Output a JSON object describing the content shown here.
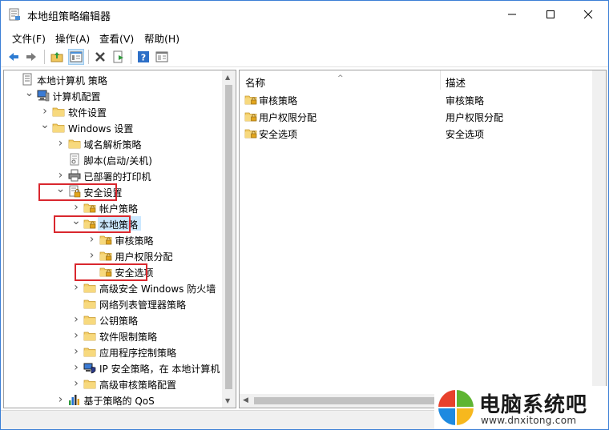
{
  "window": {
    "title": "本地组策略编辑器",
    "controls": {
      "minimize": "minimize",
      "maximize": "maximize",
      "close": "close"
    }
  },
  "menu": [
    {
      "label": "文件(F)"
    },
    {
      "label": "操作(A)"
    },
    {
      "label": "查看(V)"
    },
    {
      "label": "帮助(H)"
    }
  ],
  "toolbar": {
    "icons": [
      "back-arrow-icon",
      "forward-arrow-icon",
      "up-folder-icon",
      "show-tree-icon",
      "delete-icon",
      "export-list-icon",
      "help-icon",
      "properties-icon"
    ]
  },
  "tree": {
    "items": [
      {
        "label": "本地计算机 策略",
        "icon": "policy-document-icon",
        "expander": "none",
        "depth": 0
      },
      {
        "label": "计算机配置",
        "icon": "computer-icon",
        "expander": "expanded",
        "depth": 1
      },
      {
        "label": "软件设置",
        "icon": "folder-icon",
        "expander": "collapsed",
        "depth": 2
      },
      {
        "label": "Windows 设置",
        "icon": "folder-icon",
        "expander": "expanded",
        "depth": 2
      },
      {
        "label": "域名解析策略",
        "icon": "folder-icon",
        "expander": "collapsed",
        "depth": 3
      },
      {
        "label": "脚本(启动/关机)",
        "icon": "script-icon",
        "expander": "none",
        "depth": 3
      },
      {
        "label": "已部署的打印机",
        "icon": "printer-icon",
        "expander": "collapsed",
        "depth": 3
      },
      {
        "label": "安全设置",
        "icon": "security-settings-icon",
        "expander": "expanded",
        "depth": 3,
        "highlight": true
      },
      {
        "label": "帐户策略",
        "icon": "lock-folder-icon",
        "expander": "collapsed",
        "depth": 4
      },
      {
        "label": "本地策略",
        "icon": "lock-folder-icon",
        "expander": "expanded",
        "depth": 4,
        "highlight": true,
        "selected": true
      },
      {
        "label": "审核策略",
        "icon": "lock-folder-icon",
        "expander": "collapsed",
        "depth": 5
      },
      {
        "label": "用户权限分配",
        "icon": "lock-folder-icon",
        "expander": "collapsed",
        "depth": 5
      },
      {
        "label": "安全选项",
        "icon": "lock-folder-icon",
        "expander": "none",
        "depth": 5,
        "highlight": true
      },
      {
        "label": "高级安全 Windows 防火墙",
        "icon": "folder-icon",
        "expander": "collapsed",
        "depth": 4
      },
      {
        "label": "网络列表管理器策略",
        "icon": "folder-icon",
        "expander": "none",
        "depth": 4
      },
      {
        "label": "公钥策略",
        "icon": "folder-icon",
        "expander": "collapsed",
        "depth": 4
      },
      {
        "label": "软件限制策略",
        "icon": "folder-icon",
        "expander": "collapsed",
        "depth": 4
      },
      {
        "label": "应用程序控制策略",
        "icon": "folder-icon",
        "expander": "collapsed",
        "depth": 4
      },
      {
        "label": "IP 安全策略，在 本地计算机",
        "icon": "ip-security-icon",
        "expander": "collapsed",
        "depth": 4
      },
      {
        "label": "高级审核策略配置",
        "icon": "folder-icon",
        "expander": "collapsed",
        "depth": 4
      },
      {
        "label": "基于策略的 QoS",
        "icon": "qos-chart-icon",
        "expander": "collapsed",
        "depth": 3
      }
    ]
  },
  "list": {
    "columns": {
      "name": "名称",
      "description": "描述"
    },
    "rows": [
      {
        "name": "审核策略",
        "description": "审核策略"
      },
      {
        "name": "用户权限分配",
        "description": "用户权限分配"
      },
      {
        "name": "安全选项",
        "description": "安全选项"
      }
    ]
  },
  "watermark": {
    "title": "电脑系统吧",
    "url": "www.dnxitong.com"
  },
  "colors": {
    "selection": "#cce8ff",
    "highlight_box": "#d9272e",
    "folder": "#f0c75e",
    "accent": "#1f6fd1"
  }
}
